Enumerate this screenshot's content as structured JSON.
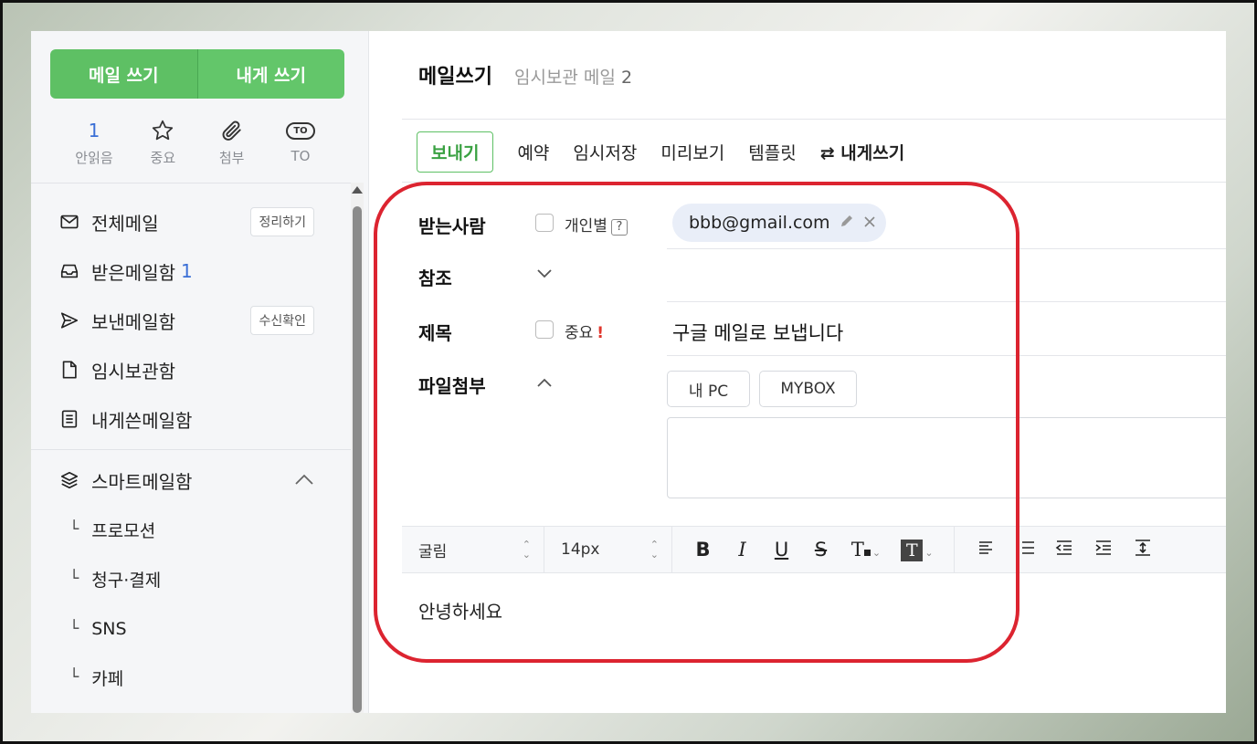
{
  "sidebar": {
    "compose_label": "메일 쓰기",
    "self_compose_label": "내게 쓰기",
    "quick": [
      {
        "value": "1",
        "label": "안읽음",
        "icon": "unread-count"
      },
      {
        "value": "",
        "label": "중요",
        "icon": "star-icon"
      },
      {
        "value": "",
        "label": "첨부",
        "icon": "paperclip-icon"
      },
      {
        "value": "TO",
        "label": "TO",
        "icon": "to-icon"
      }
    ],
    "folders": [
      {
        "label": "전체메일",
        "count": "",
        "tag": "정리하기",
        "icon": "envelope-icon"
      },
      {
        "label": "받은메일함",
        "count": "1",
        "tag": "",
        "icon": "inbox-icon"
      },
      {
        "label": "보낸메일함",
        "count": "",
        "tag": "수신확인",
        "icon": "send-icon"
      },
      {
        "label": "임시보관함",
        "count": "",
        "tag": "",
        "icon": "draft-icon"
      },
      {
        "label": "내게쓴메일함",
        "count": "",
        "tag": "",
        "icon": "note-icon"
      }
    ],
    "smart": {
      "label": "스마트메일함",
      "icon": "layers-icon",
      "items": [
        "프로모션",
        "청구·결제",
        "SNS",
        "카페"
      ]
    }
  },
  "main": {
    "title": "메일쓰기",
    "drafts_label": "임시보관 메일",
    "drafts_count": "2",
    "toolbar": {
      "send": "보내기",
      "schedule": "예약",
      "save_draft": "임시저장",
      "preview": "미리보기",
      "template": "템플릿",
      "to_self": "⇄ 내게쓰기"
    },
    "form": {
      "to_label": "받는사람",
      "individual_label": "개인별",
      "individual_help": "?",
      "recipient": "bbb@gmail.com",
      "cc_label": "참조",
      "subject_label": "제목",
      "important_label": "중요",
      "important_mark": "!",
      "subject_value": "구글 메일로 보냅니다",
      "attach_label": "파일첨부",
      "attach_pc": "내 PC",
      "attach_mybox": "MYBOX"
    },
    "editor": {
      "font": "굴림",
      "size": "14px",
      "body": "안녕하세요"
    }
  },
  "colors": {
    "accent_green": "#5ec064",
    "highlight_red": "#dc2430",
    "count_blue": "#3b6fd6"
  }
}
